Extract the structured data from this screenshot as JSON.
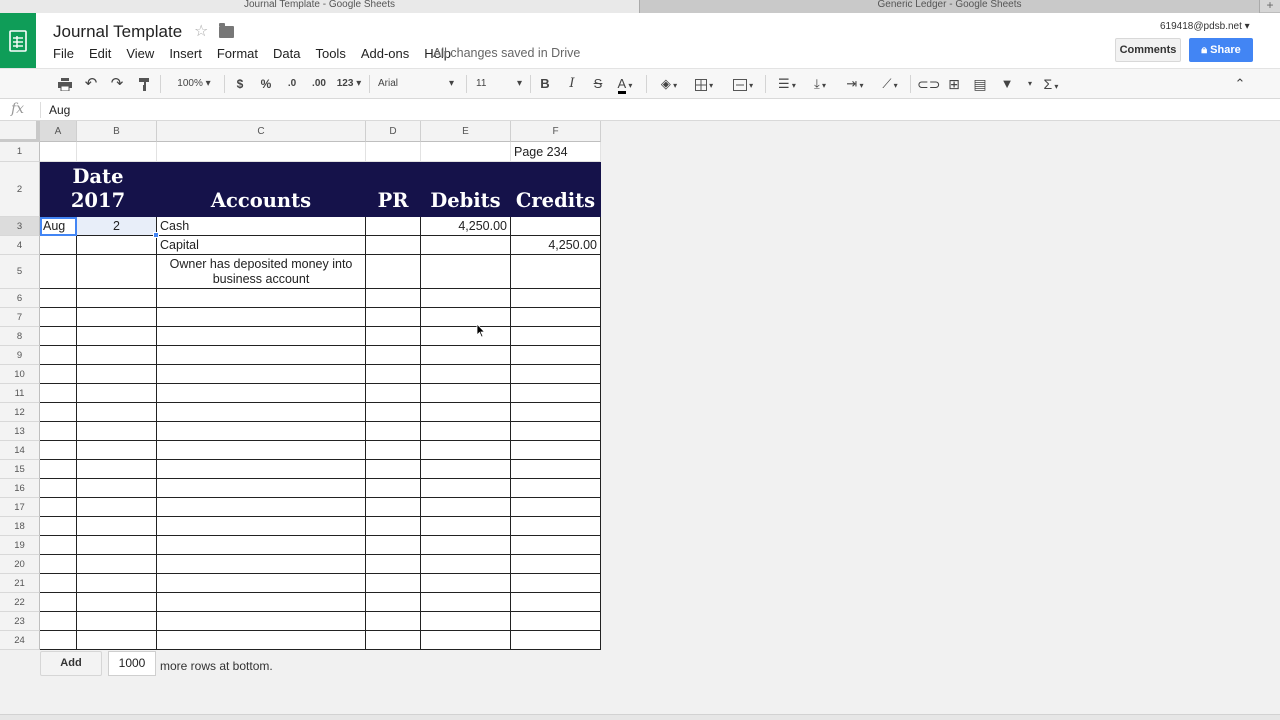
{
  "browser": {
    "tabs": [
      {
        "label": "Journal Template - Google Sheets"
      },
      {
        "label": "Generic Ledger - Google Sheets"
      }
    ]
  },
  "header": {
    "title": "Journal Template",
    "saved_status": "All changes saved in Drive",
    "account_email": "619418@pdsb.net",
    "comments_label": "Comments",
    "share_label": "Share",
    "menu": [
      "File",
      "Edit",
      "View",
      "Insert",
      "Format",
      "Data",
      "Tools",
      "Add-ons",
      "Help"
    ]
  },
  "toolbar": {
    "zoom": "100%",
    "currency": "$",
    "percent": "%",
    "decrease_decimal": ".0",
    "increase_decimal": ".00",
    "more_formats": "123",
    "font": "Arial",
    "font_size": "11",
    "bold": "B",
    "italic": "I",
    "strike": "S",
    "text_color": "A"
  },
  "formula_bar": {
    "fx": "fx",
    "value": "Aug"
  },
  "grid": {
    "columns": [
      "A",
      "B",
      "C",
      "D",
      "E",
      "F"
    ],
    "rows": [
      "1",
      "2",
      "3",
      "4",
      "5",
      "6",
      "7",
      "8",
      "9",
      "10",
      "11",
      "12",
      "13",
      "14",
      "15",
      "16",
      "17",
      "18",
      "19",
      "20",
      "21",
      "22",
      "23",
      "24"
    ],
    "cells": {
      "F1": "Page 234",
      "A2": "Date",
      "A2b": "2017",
      "C2": "Accounts",
      "D2": "PR",
      "E2": "Debits",
      "F2": "Credits",
      "A3": "Aug",
      "B3": "2",
      "C3": "Cash",
      "E3": "4,250.00",
      "C4": "Capital",
      "F4": "4,250.00",
      "C5": "Owner has deposited money into business account"
    }
  },
  "footer": {
    "add_label": "Add",
    "rows_value": "1000",
    "rows_text": "more rows at bottom."
  },
  "colors": {
    "header_fill": "#15124a",
    "sheets_green": "#0f9d58",
    "share_blue": "#4285f4"
  }
}
